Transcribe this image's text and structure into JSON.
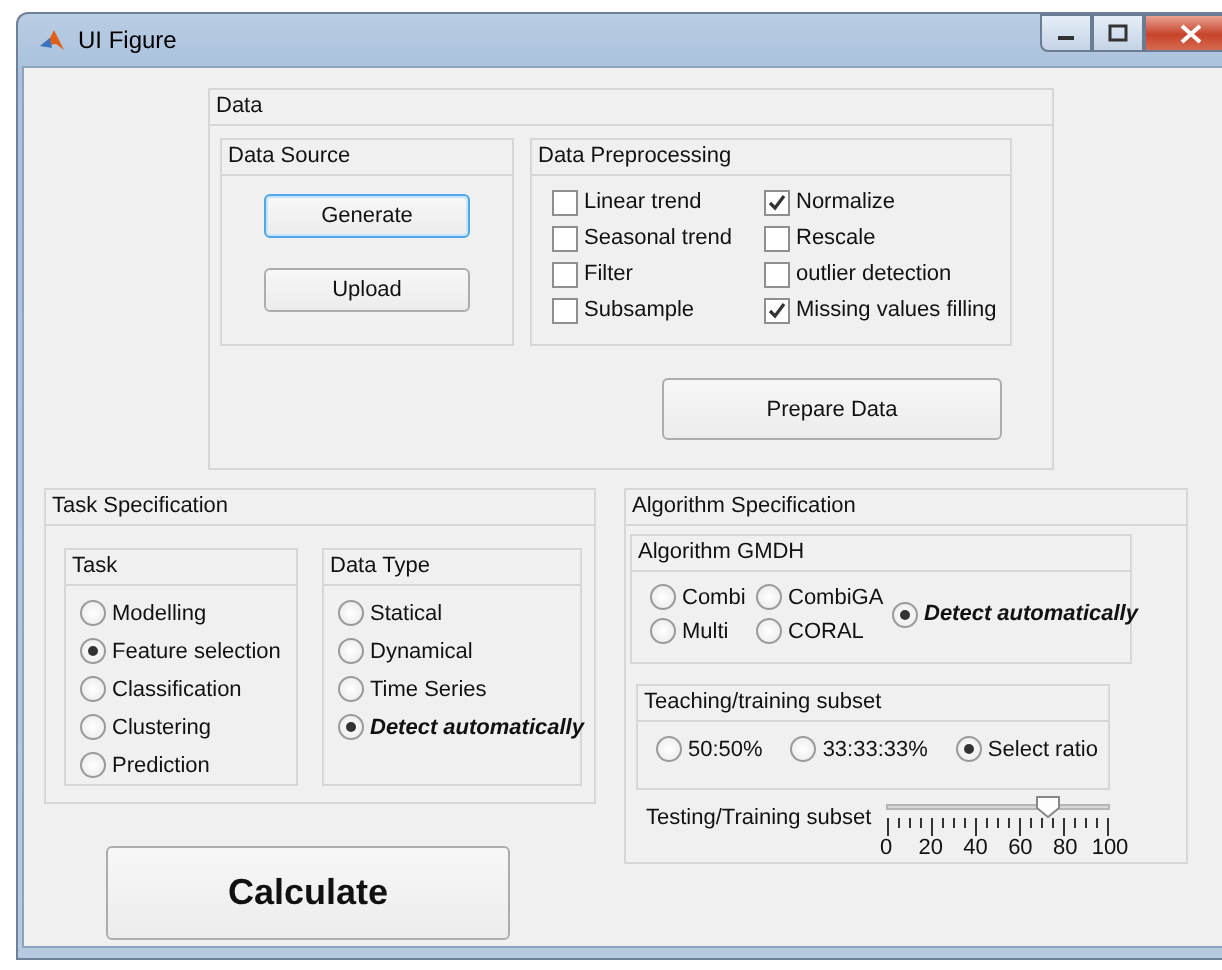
{
  "window": {
    "title": "UI Figure"
  },
  "data_panel": {
    "title": "Data",
    "source": {
      "title": "Data Source",
      "buttons": [
        {
          "label": "Generate",
          "focused": true
        },
        {
          "label": "Upload",
          "focused": false
        }
      ]
    },
    "preprocessing": {
      "title": "Data Preprocessing",
      "options": [
        {
          "label": "Linear trend",
          "checked": false
        },
        {
          "label": "Seasonal trend",
          "checked": false
        },
        {
          "label": "Filter",
          "checked": false
        },
        {
          "label": "Subsample",
          "checked": false
        },
        {
          "label": "Normalize",
          "checked": true
        },
        {
          "label": "Rescale",
          "checked": false
        },
        {
          "label": "outlier detection",
          "checked": false
        },
        {
          "label": "Missing values filling",
          "checked": true
        }
      ]
    },
    "prepare_button": "Prepare Data"
  },
  "task_spec": {
    "title": "Task Specification",
    "task": {
      "title": "Task",
      "options": [
        {
          "label": "Modelling",
          "selected": false
        },
        {
          "label": "Feature selection",
          "selected": true
        },
        {
          "label": "Classification",
          "selected": false
        },
        {
          "label": "Clustering",
          "selected": false
        },
        {
          "label": "Prediction",
          "selected": false
        }
      ]
    },
    "data_type": {
      "title": "Data Type",
      "options": [
        {
          "label": "Statical",
          "selected": false
        },
        {
          "label": "Dynamical",
          "selected": false
        },
        {
          "label": "Time Series",
          "selected": false
        },
        {
          "label": "Detect automatically",
          "selected": true,
          "emphasis": true
        }
      ]
    }
  },
  "algorithm_spec": {
    "title": "Algorithm Specification",
    "gmdh": {
      "title": "Algorithm GMDH",
      "options": [
        {
          "label": "Combi",
          "selected": false
        },
        {
          "label": "CombiGA",
          "selected": false
        },
        {
          "label": "Detect automatically",
          "selected": true,
          "emphasis": true
        },
        {
          "label": "Multi",
          "selected": false
        },
        {
          "label": "CORAL",
          "selected": false
        }
      ]
    },
    "subset": {
      "title": "Teaching/training subset",
      "options": [
        {
          "label": "50:50%",
          "selected": false
        },
        {
          "label": "33:33:33%",
          "selected": false
        },
        {
          "label": "Select ratio",
          "selected": true
        }
      ]
    },
    "slider": {
      "label": "Testing/Training subset",
      "level": 0.73,
      "tick_labels": [
        "0",
        "20",
        "40",
        "60",
        "80",
        "100"
      ]
    }
  },
  "calculate_button": "Calculate"
}
